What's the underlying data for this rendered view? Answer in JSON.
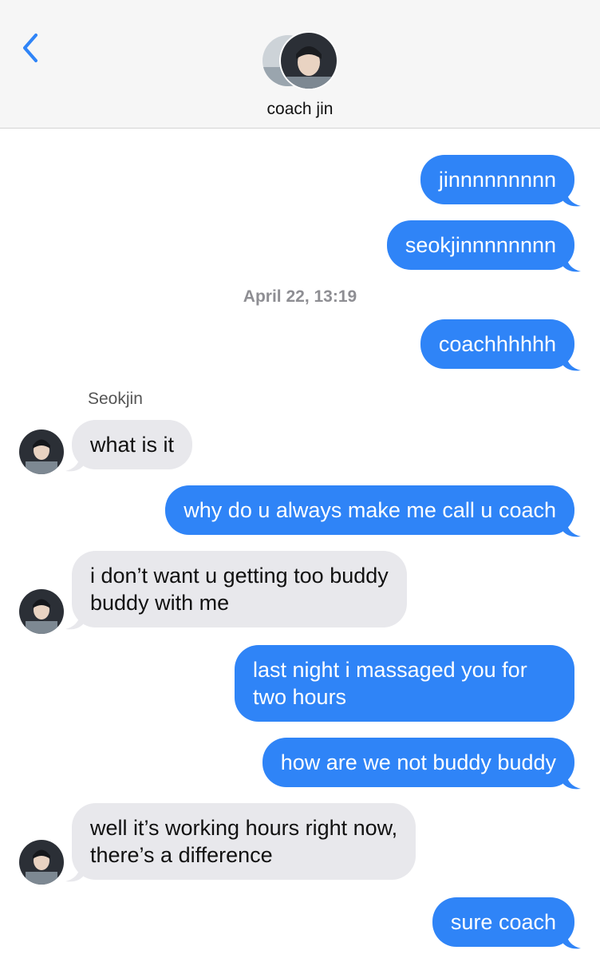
{
  "header": {
    "contact_name": "coach jin",
    "back_icon": "chevron-left-icon",
    "accent": "#2f84f7"
  },
  "conversation": {
    "timestamp": "April 22, 13:19",
    "sender_label": "Seokjin",
    "messages": [
      {
        "direction": "out",
        "text": "jinnnnnnnnn"
      },
      {
        "direction": "out",
        "text": "seokjinnnnnnnn"
      },
      {
        "direction": "out",
        "text": "coachhhhhh"
      },
      {
        "direction": "in",
        "text": "what is it"
      },
      {
        "direction": "out",
        "text": "why do u always make me call u coach"
      },
      {
        "direction": "in",
        "line1": "i don’t want u getting too buddy",
        "line2": "buddy with me"
      },
      {
        "direction": "out",
        "line1": "last night i massaged you for",
        "line2": "two hours"
      },
      {
        "direction": "out",
        "text": "how are we not buddy buddy"
      },
      {
        "direction": "in",
        "line1": "well it’s working hours right now,",
        "line2": "there’s a difference"
      },
      {
        "direction": "out",
        "text": "sure coach"
      }
    ]
  },
  "colors": {
    "outgoing_bubble": "#2f84f7",
    "incoming_bubble": "#e8e8ec",
    "header_bg": "#f6f6f6",
    "timestamp": "#8e8e93"
  }
}
